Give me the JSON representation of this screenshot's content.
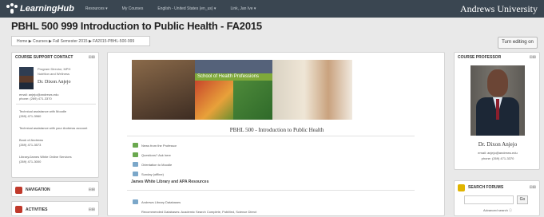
{
  "topbar": {
    "logo": "LearningHub",
    "nav": [
      "Resources ▾",
      "My Courses",
      "English - United States (en_us) ▾",
      "Link, Jan Ive ▾"
    ],
    "brand": "Andrews University"
  },
  "page_title": "PBHL 500 999 Introduction to Public Health - FA2015",
  "breadcrumb": "Home ▶ Courses ▶ Fall Semester 2015 ▶ FA2015-PBHL-500-999",
  "turn_editing": "Turn editing on",
  "course_support": {
    "title": "COURSE SUPPORT CONTACT",
    "role_line1": "Program Director, MPH",
    "role_line2": "Nutrition and Wellness",
    "name": "Dr. Dixon Anjejo",
    "email": "email: anjejo@andrews.edu",
    "phone": "phone: (269) 471-3370",
    "lines": [
      "Technical assistance with Moodle",
      "(269) 471-3960",
      "Technical assistance with your Andrews account",
      "Book of Andrews",
      "(269) 471-3573",
      "Library/James White Online Services",
      "(269) 471-3000"
    ]
  },
  "navigation_block": {
    "title": "NAVIGATION"
  },
  "activities_block": {
    "title": "ACTIVITIES"
  },
  "main": {
    "banner_label": "School of Health Professions",
    "course_heading": "PBHL 500 - Introduction to Public Health",
    "resources": [
      "News from the Professor",
      "Questions? Ask here",
      "Orientation to Moodle",
      "Sunday (offline)"
    ],
    "section_label": "James White Library and APA Resources",
    "library_resource": "Andrews Library Databases",
    "library_note": "Recommended Databases: Academic Search Complete, PubMed, Science Direct"
  },
  "professor": {
    "title": "COURSE PROFESSOR",
    "name": "Dr. Dixon Anjejo",
    "email": "email: anjejo@andrews.edu",
    "phone": "phone: (269) 471-3370"
  },
  "search_forums": {
    "title": "SEARCH FORUMS",
    "go": "Go",
    "advanced": "Advanced search ⓘ"
  },
  "colors": {
    "topbar": "#3a4651",
    "banner_label": "#7fa93a",
    "badge_red": "#c0392b",
    "badge_yellow": "#e0b400"
  }
}
